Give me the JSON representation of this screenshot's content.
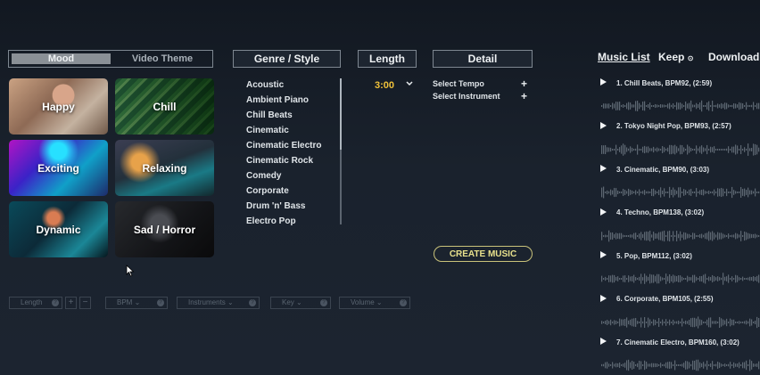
{
  "mood_tabs": {
    "active": "Mood",
    "inactive": "Video Theme"
  },
  "moods": [
    "Happy",
    "Chill",
    "Exciting",
    "Relaxing",
    "Dynamic",
    "Sad / Horror"
  ],
  "headers": {
    "genre": "Genre / Style",
    "length": "Length",
    "detail": "Detail"
  },
  "genres": [
    "Acoustic",
    "Ambient Piano",
    "Chill Beats",
    "Cinematic",
    "Cinematic Electro",
    "Cinematic Rock",
    "Comedy",
    "Corporate",
    "Drum 'n' Bass",
    "Electro Pop"
  ],
  "length": {
    "value": "3:00",
    "icon": "chevron-down-icon"
  },
  "detail": {
    "tempo": "Select Tempo",
    "instrument": "Select Instrument",
    "add_icon": "plus-icon"
  },
  "create_button": "CREATE MUSIC",
  "bottom_controls": {
    "length": "Length",
    "plus": "+",
    "minus": "−",
    "bpm": "BPM",
    "instruments": "Instruments",
    "key": "Key",
    "volume": "Volume"
  },
  "music_panel": {
    "tabs": {
      "list": "Music List",
      "keep": "Keep",
      "download": "Download"
    },
    "tracks": [
      "1. Chill Beats, BPM92, (2:59)",
      "2. Tokyo Night Pop, BPM93, (2:57)",
      "3. Cinematic, BPM90, (3:03)",
      "4. Techno, BPM138, (3:02)",
      "5. Pop, BPM112, (3:02)",
      "6. Corporate, BPM105, (2:55)",
      "7. Cinematic Electro, BPM160, (3:02)"
    ]
  },
  "colors": {
    "accent_yellow": "#f0c23a",
    "button_outline": "#c9c27a",
    "background": "#1a222d"
  }
}
